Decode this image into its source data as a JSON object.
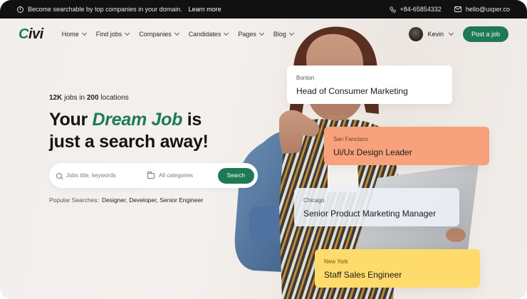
{
  "topbar": {
    "announcement": "Become searchable by top companies in your domain.",
    "learn_more": "Learn more",
    "phone": "+84-65854332",
    "email": "hello@uxper.co"
  },
  "header": {
    "logo_initial": "C",
    "logo_rest": "ivi",
    "nav": [
      "Home",
      "Find jobs",
      "Companies",
      "Candidates",
      "Pages",
      "Blog"
    ],
    "user_name": "Kevin",
    "post_button": "Post a job"
  },
  "hero": {
    "count_num": "12K",
    "count_mid": "jobs in",
    "count_loc": "200",
    "count_end": "locations",
    "title_before": "Your",
    "title_accent": "Dream Job",
    "title_after": "is",
    "title_line2": "just a search away!"
  },
  "search": {
    "keywords_placeholder": "Jobs title, keywords",
    "category_value": "All categories",
    "button": "Search"
  },
  "popular": {
    "label": "Popular Searches:",
    "terms": "Designer, Developer, Senior Engineer"
  },
  "job_cards": [
    {
      "city": "Bonton",
      "role": "Head of Consumer Marketing"
    },
    {
      "city": "San Fancisco",
      "role": "Ui/Ux Design Leader"
    },
    {
      "city": "Chicago",
      "role": "Senior Product Marketing Manager"
    },
    {
      "city": "New York",
      "role": "Staff Sales Engineer"
    }
  ],
  "colors": {
    "brand": "#1d7a55",
    "card_salmon": "#f8a27c",
    "card_yellow": "#fedb6b"
  }
}
